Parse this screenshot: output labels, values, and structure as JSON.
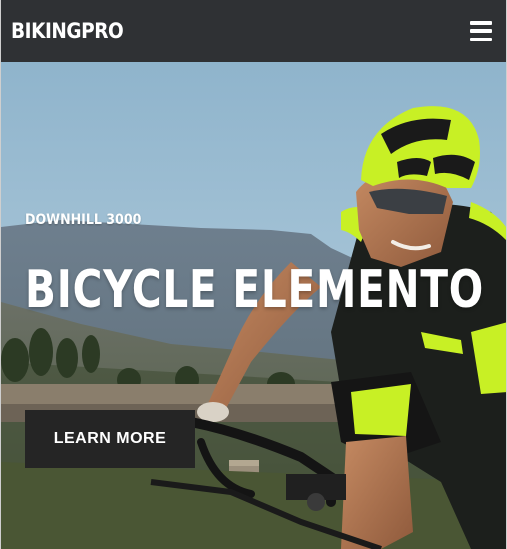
{
  "header": {
    "brand": "BIKINGPRO",
    "menu_icon": "hamburger-menu-icon"
  },
  "hero": {
    "subtitle": "DOWNHILL 3000",
    "title": "BICYCLE ELEMENTO",
    "cta_label": "LEARN MORE",
    "image": "cyclist-riding-mountain-road-photo"
  },
  "colors": {
    "header_bg": "#2f3134",
    "cta_bg": "#252525",
    "accent_lime": "#c8f025",
    "text": "#ffffff"
  }
}
